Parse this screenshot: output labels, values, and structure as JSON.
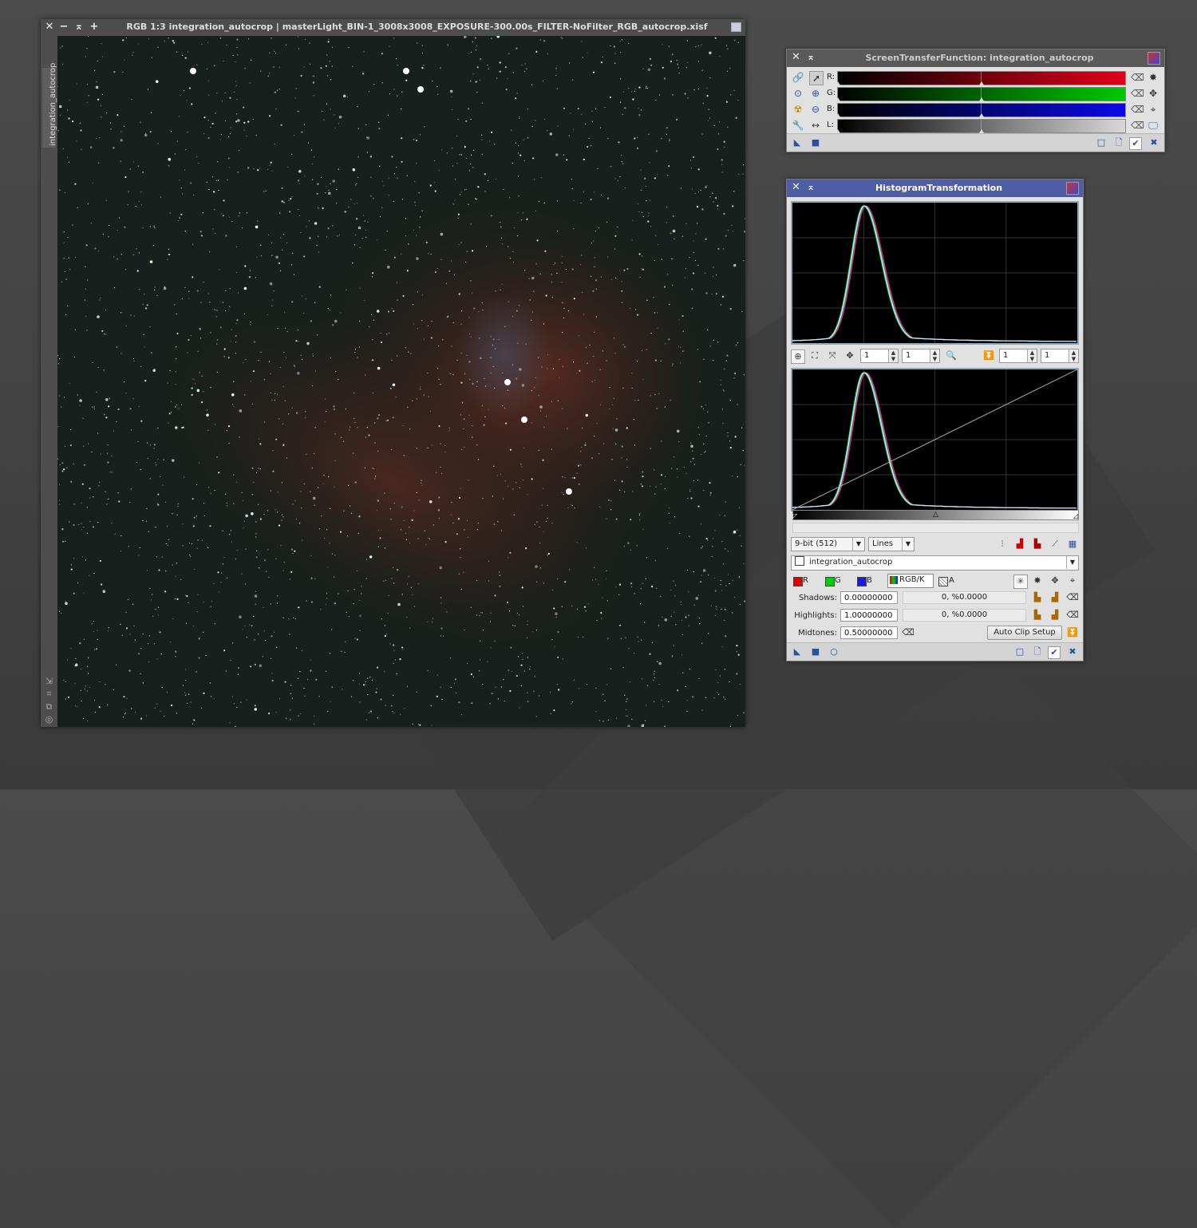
{
  "image_window": {
    "title": "RGB 1:3 integration_autocrop | masterLight_BIN-1_3008x3008_EXPOSURE-300.00s_FILTER-NoFilter_RGB_autocrop.xisf",
    "view_tab": "integration_autocrop",
    "controls": {
      "close": "✕",
      "minimize": "−",
      "shade": "⌅",
      "maximize": "+"
    }
  },
  "stf": {
    "title": "ScreenTransferFunction: integration_autocrop",
    "channels": [
      {
        "label": "R:",
        "color": "#e0001a"
      },
      {
        "label": "G:",
        "color": "#00c800"
      },
      {
        "label": "B:",
        "color": "#0a0ae6"
      },
      {
        "label": "L:",
        "color": "#d8d8d8"
      }
    ],
    "left_icons": [
      "link-icon",
      "pointer-icon",
      "zoom-icon",
      "zoom-in-icon",
      "radiation-icon",
      "zoom-out-icon",
      "wrench-icon",
      "arrows-icon"
    ]
  },
  "ht": {
    "title": "HistogramTransformation",
    "zoom": {
      "h": "1",
      "v": "1",
      "h2": "1",
      "v2": "1"
    },
    "resolution": "9-bit (512)",
    "graph_style": "Lines",
    "view": "integration_autocrop",
    "channels": [
      {
        "label": "R",
        "color": "#e00000"
      },
      {
        "label": "G",
        "color": "#00d000"
      },
      {
        "label": "B",
        "color": "#1a1ae0"
      },
      {
        "label": "RGB/K",
        "color": ""
      },
      {
        "label": "A",
        "color": ""
      }
    ],
    "shadows": {
      "label": "Shadows:",
      "value": "0.00000000",
      "clip": "0, %0.0000"
    },
    "highlights": {
      "label": "Highlights:",
      "value": "1.00000000",
      "clip": "0, %0.0000"
    },
    "midtones": {
      "label": "Midtones:",
      "value": "0.50000000"
    },
    "auto_clip": "Auto Clip Setup"
  }
}
